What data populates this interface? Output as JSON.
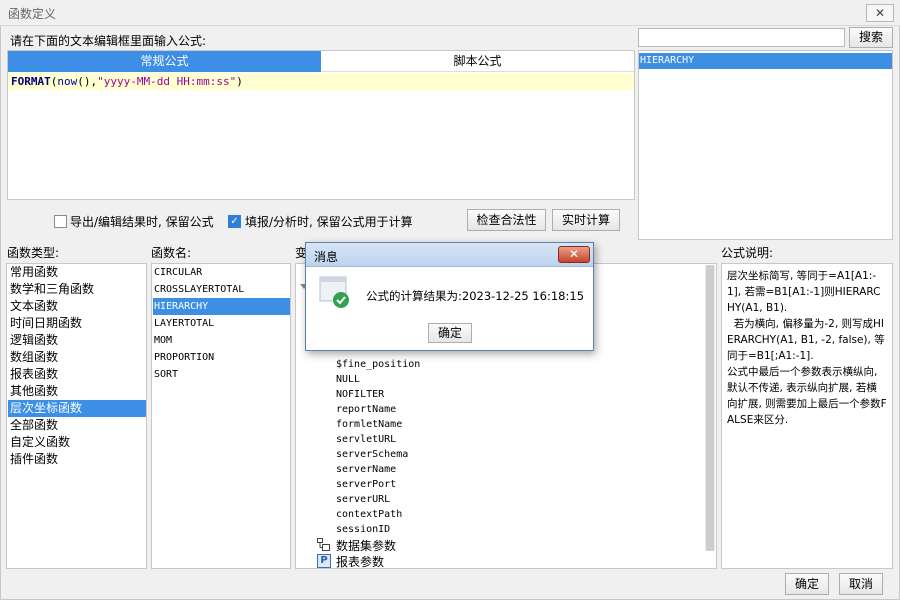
{
  "window": {
    "title": "函数定义",
    "close_glyph": "✕"
  },
  "editor": {
    "instruction": "请在下面的文本编辑框里面输入公式:",
    "tabs": [
      {
        "label": "常规公式",
        "active": true
      },
      {
        "label": "脚本公式",
        "active": false
      }
    ],
    "formula": {
      "fn": "FORMAT",
      "open": "(",
      "inner_fn": "now",
      "mid": "(),",
      "str": "\"yyyy-MM-dd HH:mm:ss\"",
      "close": ")"
    }
  },
  "search": {
    "value": "",
    "button_label": "搜索",
    "results": [
      "HIERARCHY"
    ],
    "selected_result": "HIERARCHY"
  },
  "options": {
    "keep_on_export": {
      "label": "导出/编辑结果时, 保留公式",
      "checked": false
    },
    "keep_on_fill": {
      "label": "填报/分析时, 保留公式用于计算",
      "checked": true
    },
    "check_label": "检查合法性",
    "realtime_label": "实时计算"
  },
  "categories": {
    "label": "函数类型:",
    "items": [
      "常用函数",
      "数学和三角函数",
      "文本函数",
      "时间日期函数",
      "逻辑函数",
      "数组函数",
      "报表函数",
      "其他函数",
      "层次坐标函数",
      "全部函数",
      "自定义函数",
      "插件函数"
    ],
    "selected": "层次坐标函数"
  },
  "functions": {
    "label": "函数名:",
    "items": [
      "CIRCULAR",
      "CROSSLAYERTOTAL",
      "HIERARCHY",
      "LAYERTOTAL",
      "MOM",
      "PROPORTION",
      "SORT"
    ],
    "selected": "HIERARCHY"
  },
  "variables": {
    "label_partial": "变",
    "items": [
      "$fine_position",
      "NULL",
      "NOFILTER",
      "reportName",
      "formletName",
      "servletURL",
      "serverSchema",
      "serverName",
      "serverPort",
      "serverURL",
      "contextPath",
      "sessionID"
    ],
    "groups": [
      {
        "label": "数据集参数",
        "icon": "dataset-param-icon"
      },
      {
        "label": "报表参数",
        "icon": "report-param-icon",
        "icon_glyph": "P"
      }
    ]
  },
  "description": {
    "label": "公式说明:",
    "text": "层次坐标简写, 等同于=A1[A1:-1], 若需=B1[A1:-1]则HIERARCHY(A1, B1).\n  若为横向, 偏移量为-2, 则写成HIERARCHY(A1, B1, -2, false), 等同于=B1[;A1:-1].\n公式中最后一个参数表示横纵向, 默认不传递, 表示纵向扩展, 若横向扩展, 则需要加上最后一个参数FALSE来区分."
  },
  "footer": {
    "ok_label": "确定",
    "cancel_label": "取消"
  },
  "message_dialog": {
    "title": "消息",
    "close_glyph": "✕",
    "text": "公式的计算结果为:2023-12-25 16:18:15",
    "ok_label": "确定",
    "icon": "success-check-icon"
  },
  "colors": {
    "accent": "#3d8fe6",
    "formula_highlight": "#ffffd0",
    "success": "#2ea44f",
    "close_red": "#c8442a"
  }
}
